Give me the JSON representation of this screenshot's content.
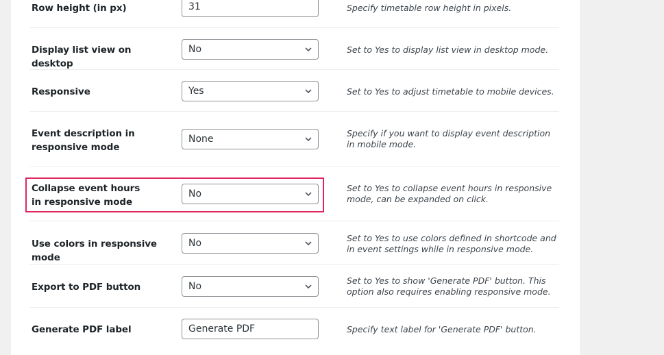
{
  "settings": [
    {
      "label": "Row height (in px)",
      "control": "text",
      "value": "31",
      "description": "Specify timetable row height in pixels."
    },
    {
      "label": "Display list view on desktop",
      "control": "select",
      "value": "No",
      "description": "Set to Yes to display list view in desktop mode."
    },
    {
      "label": "Responsive",
      "control": "select",
      "value": "Yes",
      "description": "Set to Yes to adjust timetable to mobile devices."
    },
    {
      "label": "Event description in responsive mode",
      "control": "select",
      "value": "None",
      "description": "Specify if you want to display event description in mobile mode."
    },
    {
      "label": "Collapse event hours in responsive mode",
      "control": "select",
      "value": "No",
      "description": "Set to Yes to collapse event hours in responsive mode, can be expanded on click.",
      "highlighted": true
    },
    {
      "label": "Use colors in responsive mode",
      "control": "select",
      "value": "No",
      "description": "Set to Yes to use colors defined in shortcode and in event settings while in responsive mode."
    },
    {
      "label": "Export to PDF button",
      "control": "select",
      "value": "No",
      "description": "Set to Yes to show 'Generate PDF' button. This option also requires enabling responsive mode."
    },
    {
      "label": "Generate PDF label",
      "control": "text",
      "value": "Generate PDF",
      "description": "Specify text label for 'Generate PDF' button."
    }
  ],
  "colors": {
    "highlight_border": "#e0245e",
    "page_background": "#f0f0f1",
    "panel_background": "#ffffff"
  }
}
